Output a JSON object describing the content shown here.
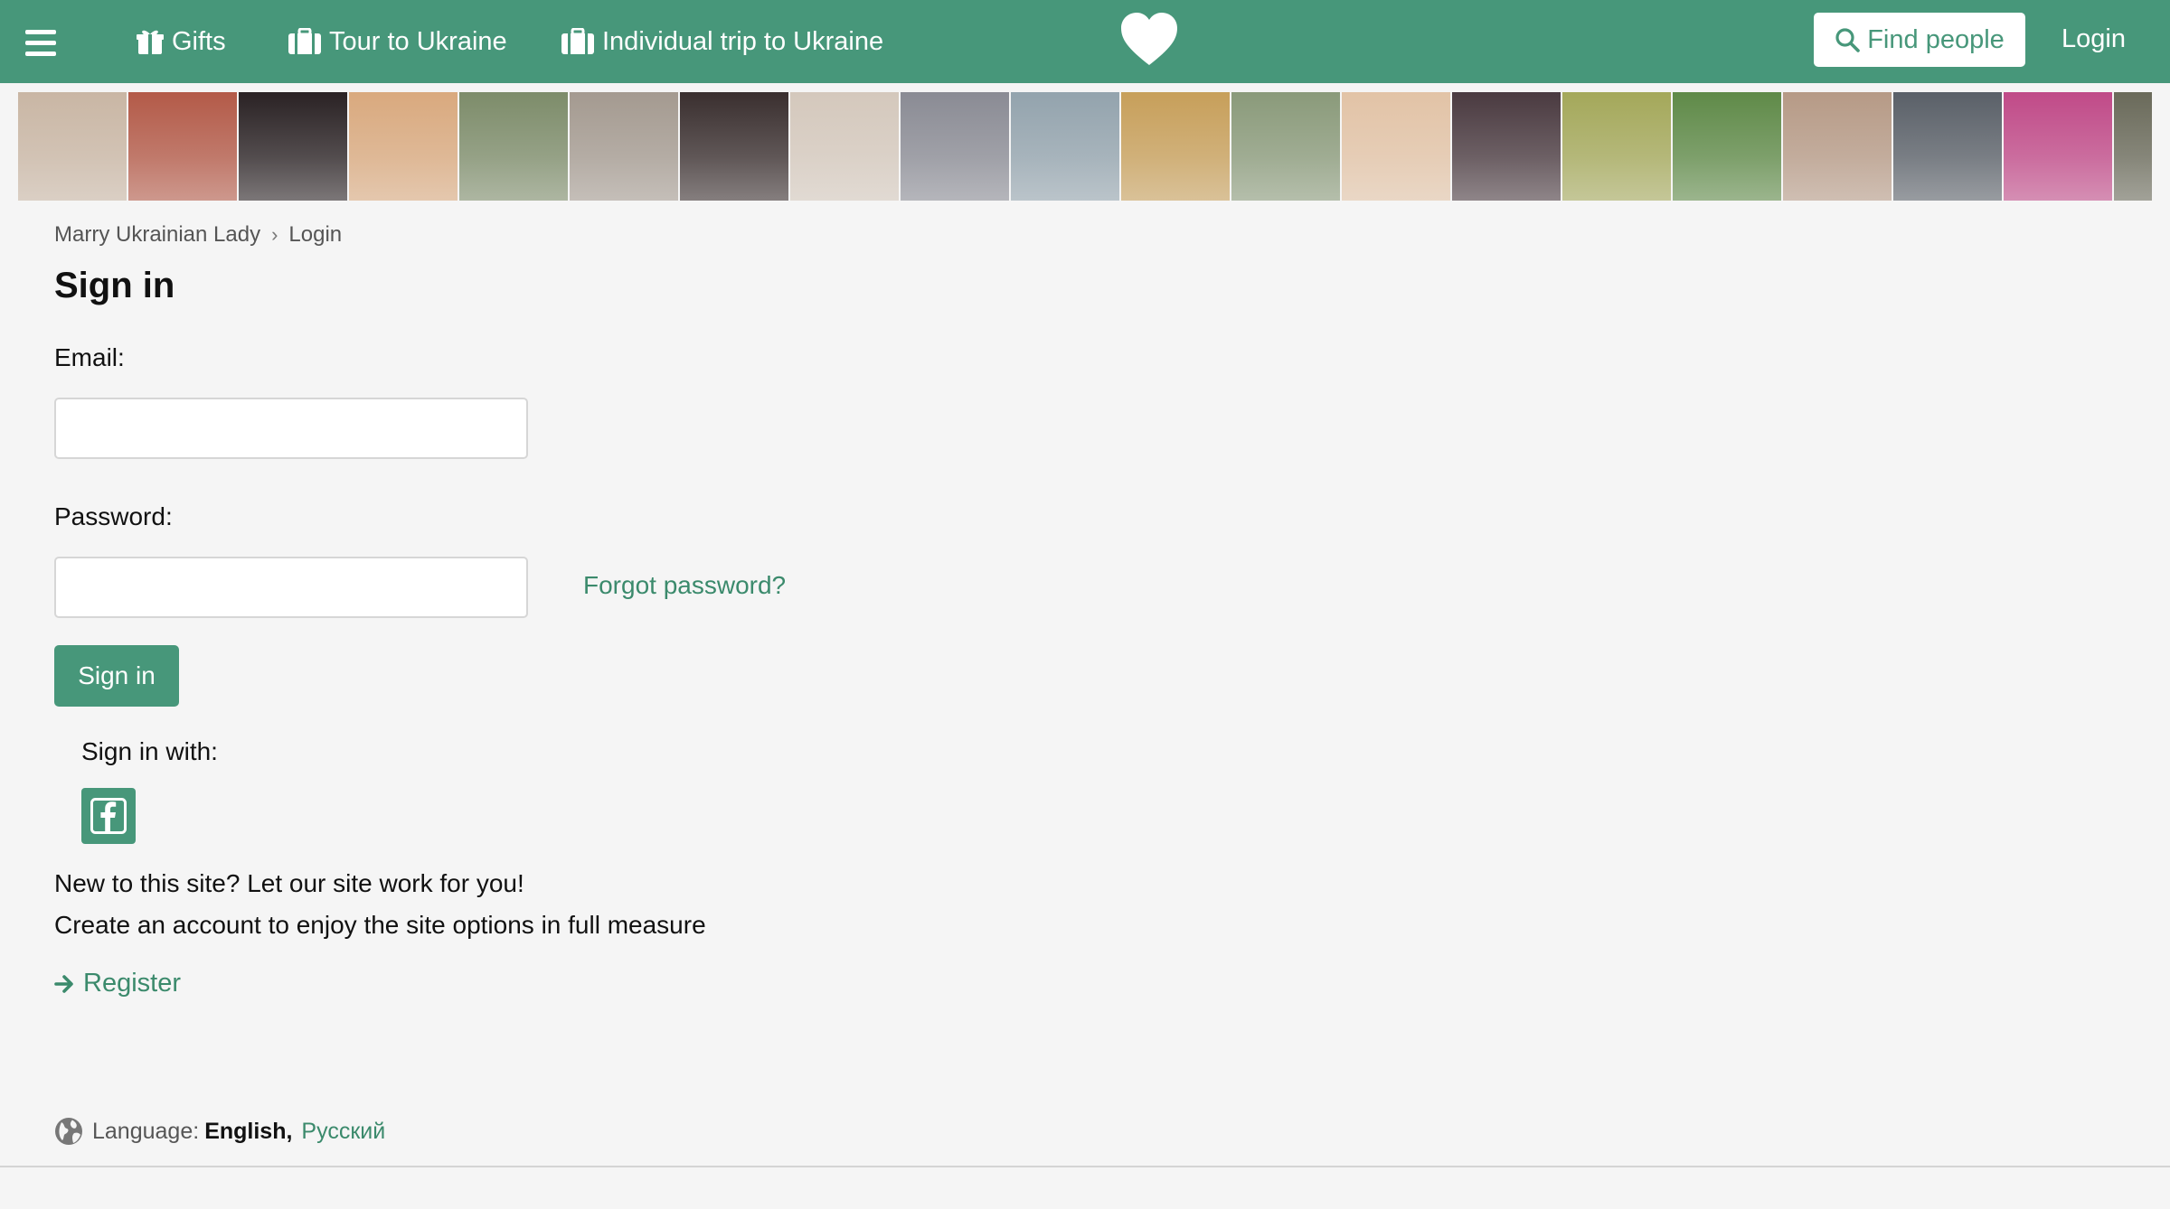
{
  "header": {
    "nav": [
      {
        "label": "Gifts",
        "icon": "gift-icon"
      },
      {
        "label": "Tour to Ukraine",
        "icon": "suitcase-icon"
      },
      {
        "label": "Individual trip to Ukraine",
        "icon": "suitcase-icon"
      }
    ],
    "logo_icon": "heart-icon",
    "find_people": "Find people",
    "login": "Login"
  },
  "photos": [
    "#c9b6a4",
    "#b35a48",
    "#2a2224",
    "#d9a97e",
    "#7d8c6a",
    "#a49a90",
    "#3a2f2f",
    "#d4c8bc",
    "#8a8b94",
    "#93a3ad",
    "#c79f5a",
    "#8a9a7a",
    "#e2c3a6",
    "#4a3a40",
    "#a4a85a",
    "#5f8a48",
    "#b69a86",
    "#5a6068",
    "#c04a88",
    "#6a6a5a"
  ],
  "breadcrumb": {
    "home": "Marry Ukrainian Lady",
    "separator": "›",
    "current": "Login"
  },
  "form": {
    "title": "Sign in",
    "email_label": "Email:",
    "email_value": "",
    "password_label": "Password:",
    "password_value": "",
    "forgot": "Forgot password?",
    "submit": "Sign in",
    "sign_in_with": "Sign in with:",
    "social_icon": "facebook-icon"
  },
  "promo": {
    "line1": "New to this site? Let our site work for you!",
    "line2": "Create an account to enjoy the site options in full measure",
    "register": "Register"
  },
  "footer": {
    "language_label": "Language:",
    "current_language": "English,",
    "alt_language": "Русский"
  },
  "colors": {
    "brand": "#47977a",
    "link": "#3b8a6c",
    "background": "#f5f5f5"
  }
}
